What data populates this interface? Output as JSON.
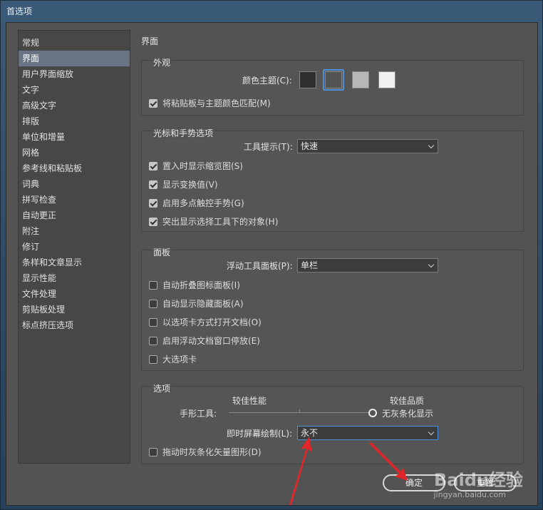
{
  "window": {
    "title": "首选项"
  },
  "sidebar": {
    "items": [
      {
        "label": "常规"
      },
      {
        "label": "界面",
        "active": true
      },
      {
        "label": "用户界面缩放"
      },
      {
        "label": "文字"
      },
      {
        "label": "高级文字"
      },
      {
        "label": "排版"
      },
      {
        "label": "单位和增量"
      },
      {
        "label": "网格"
      },
      {
        "label": "参考线和粘贴板"
      },
      {
        "label": "词典"
      },
      {
        "label": "拼写检查"
      },
      {
        "label": "自动更正"
      },
      {
        "label": "附注"
      },
      {
        "label": "修订"
      },
      {
        "label": "条样和文章显示"
      },
      {
        "label": "显示性能"
      },
      {
        "label": "文件处理"
      },
      {
        "label": "剪贴板处理"
      },
      {
        "label": "标点挤压选项"
      }
    ]
  },
  "section": {
    "title": "界面"
  },
  "appearance": {
    "title": "外观",
    "color_theme_label": "颜色主题(C):",
    "themes": [
      "#2f2f2f",
      "#535353",
      "#b8b8b8",
      "#f0f0f0"
    ],
    "selected_theme_index": 1,
    "match_pasteboard": {
      "label": "将粘贴板与主题颜色匹配(M)",
      "checked": true
    }
  },
  "cursor": {
    "title": "光标和手势选项",
    "tooltips_label": "工具提示(T):",
    "tooltips_value": "快速",
    "checks": [
      {
        "label": "置入时显示缩览图(S)",
        "checked": true
      },
      {
        "label": "显示变换值(V)",
        "checked": true
      },
      {
        "label": "启用多点触控手势(G)",
        "checked": true
      },
      {
        "label": "突出显示选择工具下的对象(H)",
        "checked": true
      }
    ]
  },
  "panels": {
    "title": "面板",
    "floating_label": "浮动工具面板(P):",
    "floating_value": "单栏",
    "checks": [
      {
        "label": "自动折叠图标面板(I)",
        "checked": false
      },
      {
        "label": "自动显示隐藏面板(A)",
        "checked": false
      },
      {
        "label": "以选项卡方式打开文档(O)",
        "checked": false
      },
      {
        "label": "启用浮动文档窗口停放(E)",
        "checked": false
      },
      {
        "label": "大选项卡",
        "checked": false
      }
    ]
  },
  "options": {
    "title": "选项",
    "perf_label": "较佳性能",
    "quality_label": "较佳品质",
    "hand_tool_label": "手形工具:",
    "no_greek_label": "无灰条化显示",
    "slider_fraction": 1.0,
    "live_draw_label": "即时屏幕绘制(L):",
    "live_draw_value": "永不",
    "greek_vector": {
      "label": "拖动时灰条化矢量图形(D)",
      "checked": false
    }
  },
  "buttons": {
    "ok": "确定",
    "reset": "重置"
  },
  "watermark": {
    "brand": "Baidu经验",
    "url": "jingyan.baidu.com"
  },
  "colors": {
    "accent": "#4a8fd8",
    "annotation": "#e0262b",
    "panel": "#535353"
  }
}
